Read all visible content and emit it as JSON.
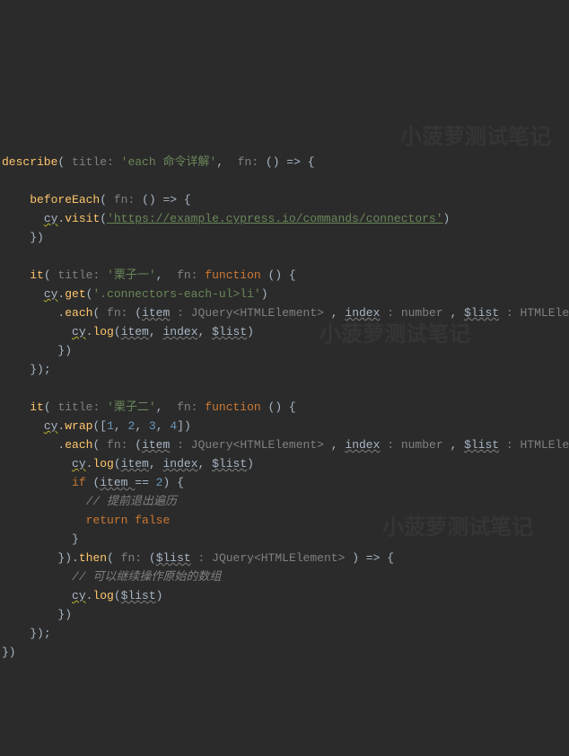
{
  "code": {
    "describe": "describe",
    "title_lbl": "title:",
    "fn_lbl": "fn:",
    "desc_title": "'each 命令详解'",
    "beforeEach": "beforeEach",
    "cy": "cy",
    "visit": "visit",
    "url": "'https://example.cypress.io/commands/connectors'",
    "it": "it",
    "chestnut1": "'栗子一'",
    "chestnut2": "'栗子二'",
    "function_kw": "function",
    "get": "get",
    "selector": "'.connectors-each-ul>li'",
    "each": "each",
    "item": "item",
    "index": "index",
    "list": "$list",
    "log": "log",
    "wrap": "wrap",
    "arr": "[1, 2, 3, 4]",
    "if_kw": "if",
    "cond": "item == 2",
    "comment_exit": "// 提前退出遍历",
    "return_kw": "return",
    "false_kw": "false",
    "then": "then",
    "comment_arr": "// 可以继续操作原始的数组",
    "t_jq": "JQuery<HTMLElement>",
    "t_num": "number",
    "t_arr": "HTMLElement[]"
  }
}
